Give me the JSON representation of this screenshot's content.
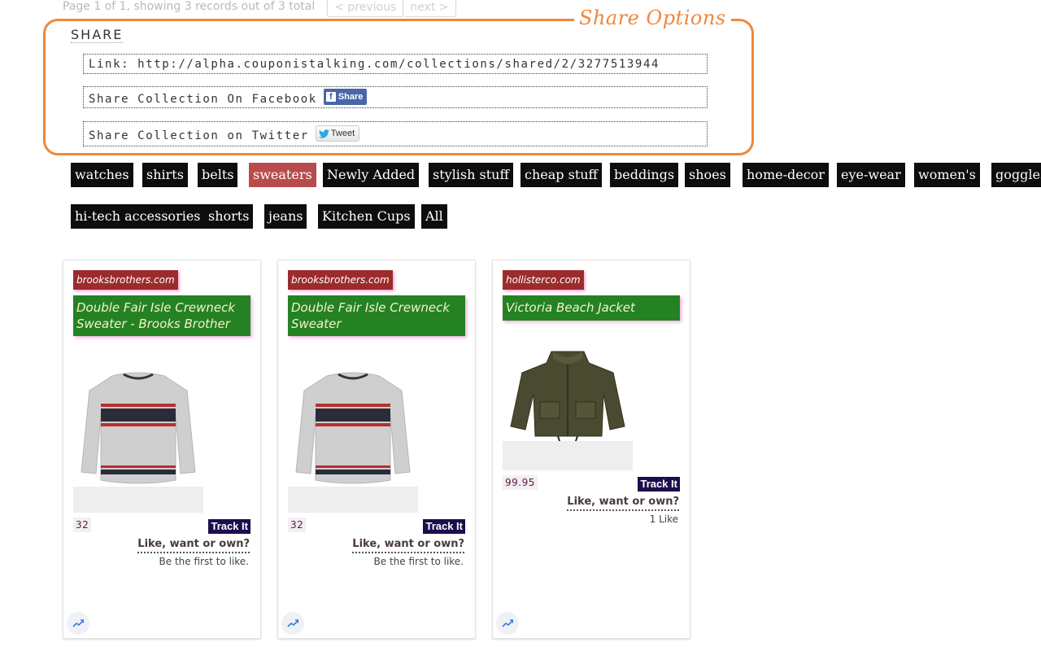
{
  "pagination": {
    "summary": "Page 1 of 1, showing 3 records out of 3 total",
    "previous_label": "< previous",
    "next_label": "next >"
  },
  "share": {
    "legend": "Share Options",
    "title": "SHARE",
    "link_label": "Link: http://alpha.couponistalking.com/collections/shared/2/3277513944",
    "facebook_label": "Share Collection On Facebook",
    "facebook_button": "Share",
    "twitter_label": "Share Collection on Twitter",
    "twitter_button": "Tweet",
    "accent_color": "#f0873a"
  },
  "tags": {
    "active": "sweaters",
    "items": [
      "watches",
      "shirts",
      "belts",
      "sweaters",
      "Newly Added",
      "stylish stuff",
      "cheap stuff",
      "beddings",
      "shoes",
      "home-decor",
      "eye-wear",
      "women's",
      "goggles",
      "hi-tech accessories",
      "shorts",
      "jeans",
      "Kitchen Cups",
      "All"
    ]
  },
  "products": [
    {
      "store": "brooksbrothers.com",
      "name": "Double Fair Isle Crewneck Sweater - Brooks Brother",
      "image_icon": "sweater-image",
      "price": "32",
      "track_label": "Track It",
      "like_prompt": "Like, want or own?",
      "like_count_text": "Be the first to like."
    },
    {
      "store": "brooksbrothers.com",
      "name": "Double Fair Isle Crewneck Sweater",
      "image_icon": "sweater-image",
      "price": "32",
      "track_label": "Track It",
      "like_prompt": "Like, want or own?",
      "like_count_text": "Be the first to like."
    },
    {
      "store": "hollisterco.com",
      "name": "Victoria Beach Jacket",
      "image_icon": "jacket-image",
      "price": "99.95",
      "track_label": "Track It",
      "like_prompt": "Like, want or own?",
      "like_count_text": "1 Like"
    }
  ],
  "icons": {
    "trend": "trending-up-icon",
    "facebook": "facebook-icon",
    "twitter": "twitter-bird-icon"
  }
}
